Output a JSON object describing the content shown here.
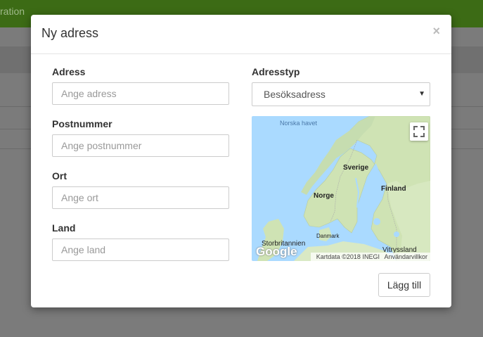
{
  "background": {
    "header_text": "ration"
  },
  "modal": {
    "title": "Ny adress",
    "close_label": "×",
    "fields": {
      "address": {
        "label": "Adress",
        "placeholder": "Ange adress"
      },
      "postal_code": {
        "label": "Postnummer",
        "placeholder": "Ange postnummer"
      },
      "city": {
        "label": "Ort",
        "placeholder": "Ange ort"
      },
      "country": {
        "label": "Land",
        "placeholder": "Ange land"
      },
      "address_type": {
        "label": "Adresstyp",
        "selected": "Besöksadress"
      }
    },
    "map": {
      "sea_label": "Norska havet",
      "labels": [
        "Sverige",
        "Norge",
        "Finland",
        "Danmark",
        "Storbritannien",
        "Vitryssland"
      ],
      "logo": "Google",
      "attribution": "Kartdata ©2018 INEGI",
      "terms": "Användarvillkor"
    },
    "submit_label": "Lägg till"
  },
  "colors": {
    "top_bar": "#3c6b15",
    "overlay": "#7b7b7b",
    "map_water": "#aadaff"
  }
}
